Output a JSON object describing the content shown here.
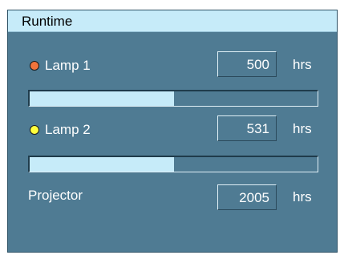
{
  "window": {
    "title": "Runtime"
  },
  "lamps": [
    {
      "label": "Lamp 1",
      "indicator_color": "#f0743c",
      "value": "500",
      "unit": "hrs",
      "progress": 0.5
    },
    {
      "label": "Lamp 2",
      "indicator_color": "#ffff3c",
      "value": "531",
      "unit": "hrs",
      "progress": 0.5
    }
  ],
  "projector": {
    "label": "Projector",
    "value": "2005",
    "unit": "hrs"
  },
  "colors": {
    "panel": "#4f7b93",
    "title_bar": "#c6ebf9",
    "bar_fill": "#c6ebf9"
  },
  "icons": {
    "lamp_indicator": "lamp-status-dot-icon"
  }
}
